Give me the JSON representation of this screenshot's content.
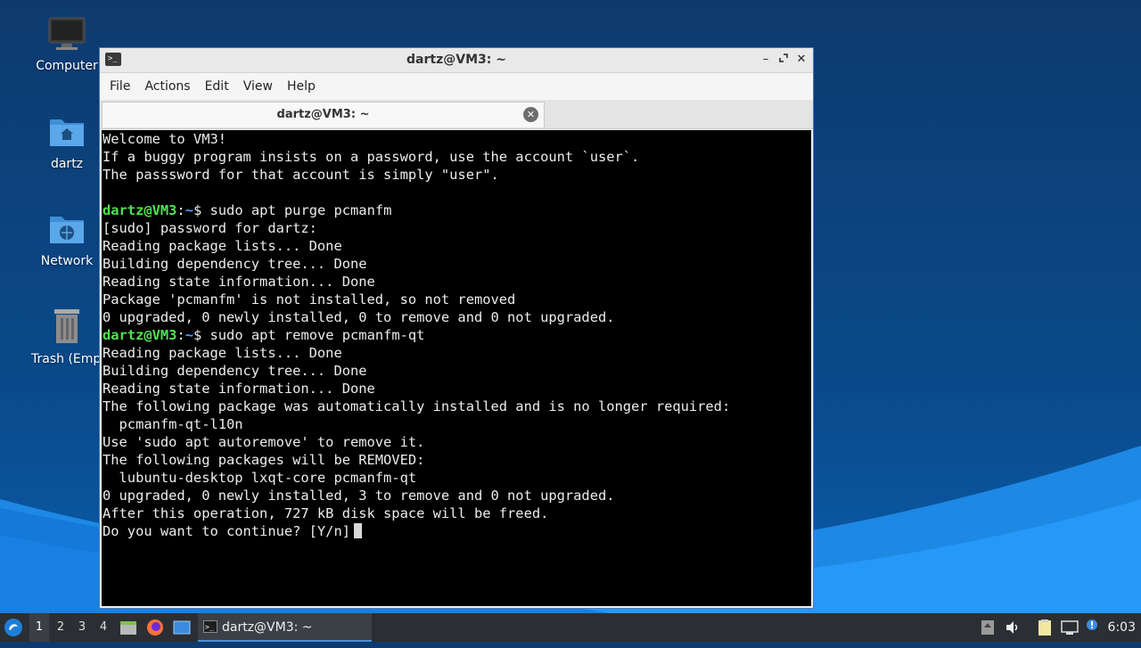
{
  "desktop": {
    "icons": [
      {
        "label": "Computer"
      },
      {
        "label": "dartz"
      },
      {
        "label": "Network"
      },
      {
        "label": "Trash (Empty)"
      }
    ]
  },
  "window": {
    "title": "dartz@VM3: ~",
    "menu": [
      "File",
      "Actions",
      "Edit",
      "View",
      "Help"
    ],
    "tab_label": "dartz@VM3: ~"
  },
  "terminal": {
    "lines": [
      {
        "type": "text",
        "text": "Welcome to VM3!"
      },
      {
        "type": "text",
        "text": "If a buggy program insists on a password, use the account `user`."
      },
      {
        "type": "text",
        "text": "The passsword for that account is simply \"user\"."
      },
      {
        "type": "text",
        "text": ""
      },
      {
        "type": "prompt",
        "user": "dartz@VM3",
        "path": "~",
        "cmd": " sudo apt purge pcmanfm"
      },
      {
        "type": "text",
        "text": "[sudo] password for dartz:"
      },
      {
        "type": "text",
        "text": "Reading package lists... Done"
      },
      {
        "type": "text",
        "text": "Building dependency tree... Done"
      },
      {
        "type": "text",
        "text": "Reading state information... Done"
      },
      {
        "type": "text",
        "text": "Package 'pcmanfm' is not installed, so not removed"
      },
      {
        "type": "text",
        "text": "0 upgraded, 0 newly installed, 0 to remove and 0 not upgraded."
      },
      {
        "type": "prompt",
        "user": "dartz@VM3",
        "path": "~",
        "cmd": " sudo apt remove pcmanfm-qt"
      },
      {
        "type": "text",
        "text": "Reading package lists... Done"
      },
      {
        "type": "text",
        "text": "Building dependency tree... Done"
      },
      {
        "type": "text",
        "text": "Reading state information... Done"
      },
      {
        "type": "text",
        "text": "The following package was automatically installed and is no longer required:"
      },
      {
        "type": "text",
        "text": "  pcmanfm-qt-l10n"
      },
      {
        "type": "text",
        "text": "Use 'sudo apt autoremove' to remove it."
      },
      {
        "type": "text",
        "text": "The following packages will be REMOVED:"
      },
      {
        "type": "text",
        "text": "  lubuntu-desktop lxqt-core pcmanfm-qt"
      },
      {
        "type": "text",
        "text": "0 upgraded, 0 newly installed, 3 to remove and 0 not upgraded."
      },
      {
        "type": "text",
        "text": "After this operation, 727 kB disk space will be freed."
      },
      {
        "type": "cursor",
        "text": "Do you want to continue? [Y/n]"
      }
    ]
  },
  "taskbar": {
    "workspaces": [
      "1",
      "2",
      "3",
      "4"
    ],
    "task_label": "dartz@VM3: ~",
    "clock": "6:03"
  }
}
